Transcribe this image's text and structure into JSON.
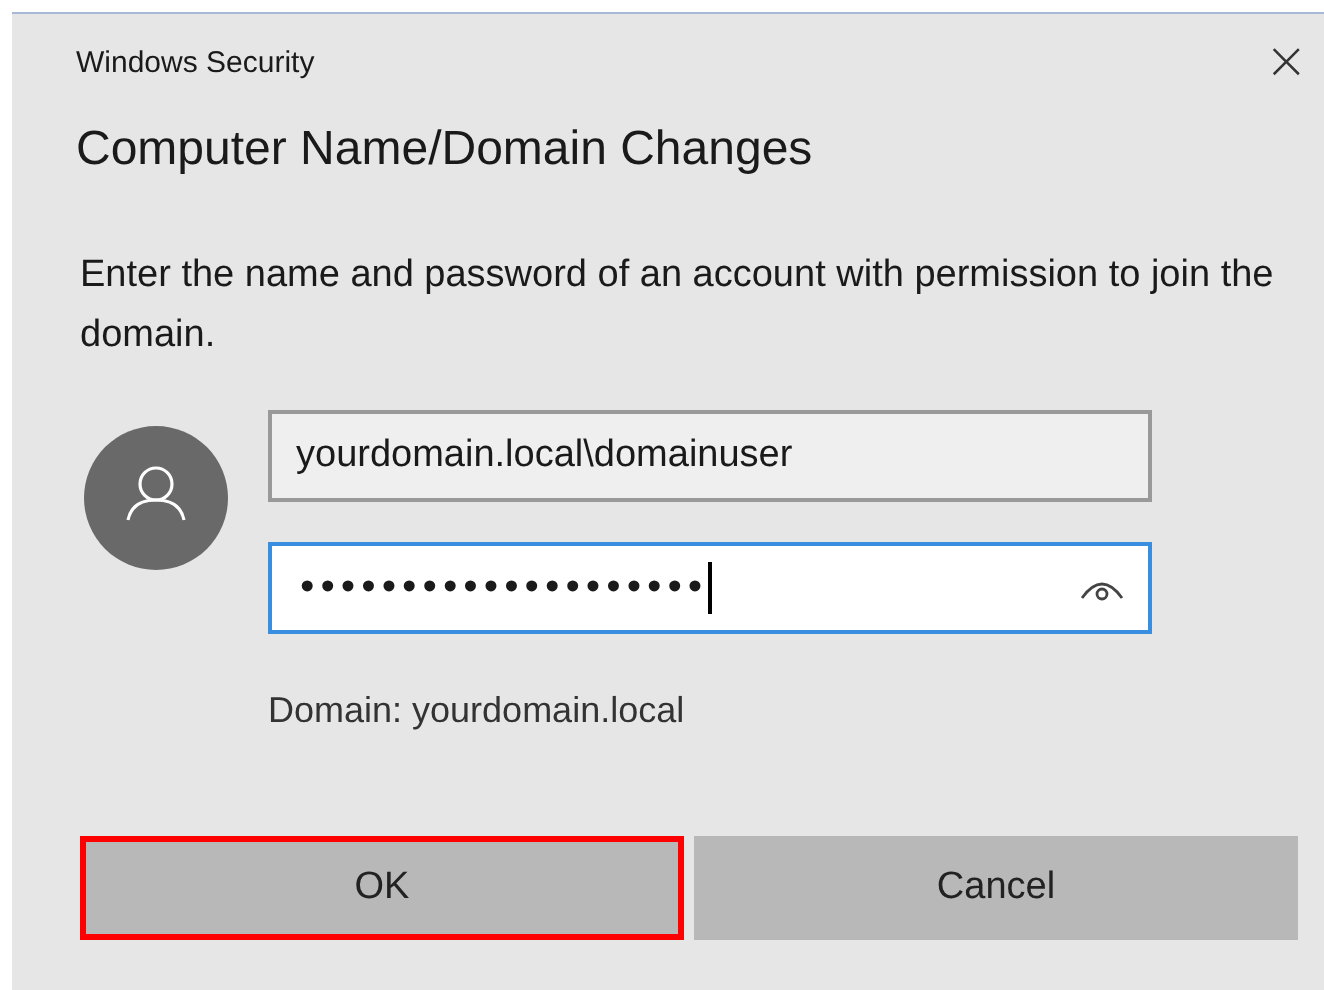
{
  "window": {
    "title": "Windows Security",
    "close": "×"
  },
  "heading": "Computer Name/Domain Changes",
  "message": "Enter the name and password of an account with permission to join the domain.",
  "fields": [
    {
      "kind": "text",
      "value": "yourdomain.local\\domainuser",
      "focused": false
    },
    {
      "kind": "password",
      "value": "••••••••••••••••••••",
      "focused": true
    }
  ],
  "domain_label": "Domain: yourdomain.local",
  "buttons": [
    {
      "label": "OK",
      "highlighted": true
    },
    {
      "label": "Cancel",
      "highlighted": false
    }
  ]
}
